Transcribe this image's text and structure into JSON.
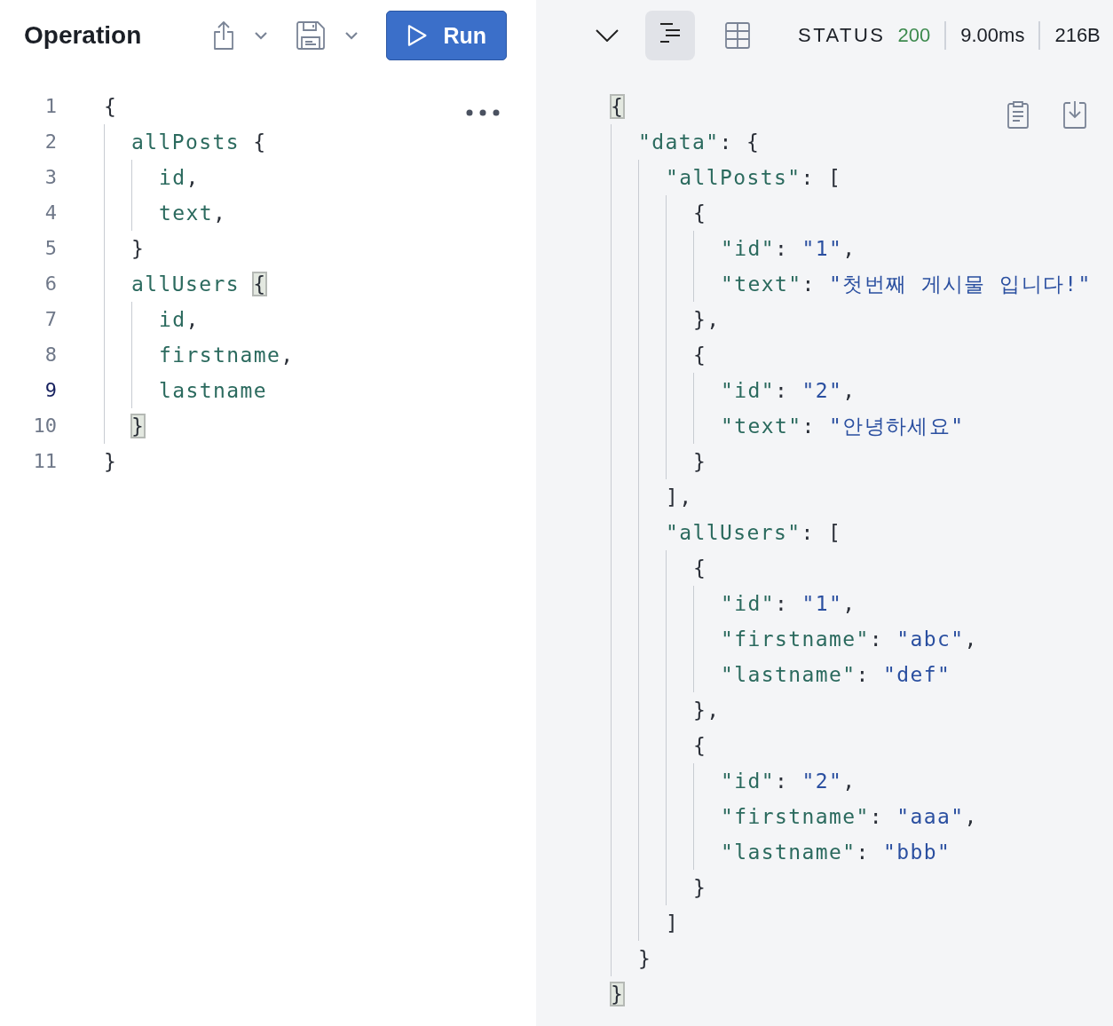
{
  "operation_panel": {
    "title": "Operation",
    "run_button": {
      "label": "Run"
    },
    "editor": {
      "lines": [
        {
          "num": "1",
          "current": false,
          "tokens": [
            {
              "text": "{",
              "kind": "punct"
            }
          ],
          "children": [
            {
              "num": "2",
              "current": false,
              "tokens": [
                {
                  "text": "allPosts",
                  "kind": "field"
                },
                {
                  "text": " {",
                  "kind": "punct"
                }
              ],
              "children": [
                {
                  "num": "3",
                  "current": false,
                  "tokens": [
                    {
                      "text": "id",
                      "kind": "field"
                    },
                    {
                      "text": ",",
                      "kind": "punct"
                    }
                  ]
                },
                {
                  "num": "4",
                  "current": false,
                  "tokens": [
                    {
                      "text": "text",
                      "kind": "field"
                    },
                    {
                      "text": ",",
                      "kind": "punct"
                    }
                  ]
                }
              ]
            },
            {
              "num": "5",
              "current": false,
              "tokens": [
                {
                  "text": "}",
                  "kind": "punct"
                }
              ]
            },
            {
              "num": "6",
              "current": false,
              "tokens": [
                {
                  "text": "allUsers",
                  "kind": "field"
                },
                {
                  "text": " {",
                  "kind": "match"
                }
              ],
              "children": [
                {
                  "num": "7",
                  "current": false,
                  "tokens": [
                    {
                      "text": "id",
                      "kind": "field"
                    },
                    {
                      "text": ",",
                      "kind": "punct"
                    }
                  ]
                },
                {
                  "num": "8",
                  "current": false,
                  "tokens": [
                    {
                      "text": "firstname",
                      "kind": "field"
                    },
                    {
                      "text": ",",
                      "kind": "punct"
                    }
                  ]
                },
                {
                  "num": "9",
                  "current": true,
                  "tokens": [
                    {
                      "text": "lastname",
                      "kind": "field"
                    }
                  ]
                }
              ]
            },
            {
              "num": "10",
              "current": false,
              "tokens": [
                {
                  "text": "}",
                  "kind": "match"
                }
              ]
            }
          ]
        },
        {
          "num": "11",
          "current": false,
          "tokens": [
            {
              "text": "}",
              "kind": "punct"
            }
          ]
        }
      ]
    }
  },
  "response_panel": {
    "view_toggles": [
      {
        "kind": "tree",
        "selected": true
      },
      {
        "kind": "table",
        "selected": false
      }
    ],
    "status": {
      "label": "STATUS",
      "code": "200",
      "time": "9.00ms",
      "size": "216B"
    },
    "result": {
      "lines": [
        {
          "tokens": [
            {
              "text": "{",
              "kind": "match"
            }
          ],
          "children": [
            {
              "tokens": [
                {
                  "text": "\"data\"",
                  "kind": "key"
                },
                {
                  "text": ": {",
                  "kind": "punct"
                }
              ],
              "children": [
                {
                  "tokens": [
                    {
                      "text": "\"allPosts\"",
                      "kind": "key"
                    },
                    {
                      "text": ": [",
                      "kind": "punct"
                    }
                  ],
                  "children": [
                    {
                      "tokens": [
                        {
                          "text": "{",
                          "kind": "punct"
                        }
                      ],
                      "children": [
                        {
                          "tokens": [
                            {
                              "text": "\"id\"",
                              "kind": "key"
                            },
                            {
                              "text": ": ",
                              "kind": "punct"
                            },
                            {
                              "text": "\"1\"",
                              "kind": "string"
                            },
                            {
                              "text": ",",
                              "kind": "punct"
                            }
                          ]
                        },
                        {
                          "tokens": [
                            {
                              "text": "\"text\"",
                              "kind": "key"
                            },
                            {
                              "text": ": ",
                              "kind": "punct"
                            },
                            {
                              "text": "\"첫번째 게시물 입니다!\"",
                              "kind": "string"
                            }
                          ]
                        }
                      ]
                    },
                    {
                      "tokens": [
                        {
                          "text": "},",
                          "kind": "punct"
                        }
                      ]
                    },
                    {
                      "tokens": [
                        {
                          "text": "{",
                          "kind": "punct"
                        }
                      ],
                      "children": [
                        {
                          "tokens": [
                            {
                              "text": "\"id\"",
                              "kind": "key"
                            },
                            {
                              "text": ": ",
                              "kind": "punct"
                            },
                            {
                              "text": "\"2\"",
                              "kind": "string"
                            },
                            {
                              "text": ",",
                              "kind": "punct"
                            }
                          ]
                        },
                        {
                          "tokens": [
                            {
                              "text": "\"text\"",
                              "kind": "key"
                            },
                            {
                              "text": ": ",
                              "kind": "punct"
                            },
                            {
                              "text": "\"안녕하세요\"",
                              "kind": "string"
                            }
                          ]
                        }
                      ]
                    },
                    {
                      "tokens": [
                        {
                          "text": "}",
                          "kind": "punct"
                        }
                      ]
                    }
                  ]
                },
                {
                  "tokens": [
                    {
                      "text": "],",
                      "kind": "punct"
                    }
                  ]
                },
                {
                  "tokens": [
                    {
                      "text": "\"allUsers\"",
                      "kind": "key"
                    },
                    {
                      "text": ": [",
                      "kind": "punct"
                    }
                  ],
                  "children": [
                    {
                      "tokens": [
                        {
                          "text": "{",
                          "kind": "punct"
                        }
                      ],
                      "children": [
                        {
                          "tokens": [
                            {
                              "text": "\"id\"",
                              "kind": "key"
                            },
                            {
                              "text": ": ",
                              "kind": "punct"
                            },
                            {
                              "text": "\"1\"",
                              "kind": "string"
                            },
                            {
                              "text": ",",
                              "kind": "punct"
                            }
                          ]
                        },
                        {
                          "tokens": [
                            {
                              "text": "\"firstname\"",
                              "kind": "key"
                            },
                            {
                              "text": ": ",
                              "kind": "punct"
                            },
                            {
                              "text": "\"abc\"",
                              "kind": "string"
                            },
                            {
                              "text": ",",
                              "kind": "punct"
                            }
                          ]
                        },
                        {
                          "tokens": [
                            {
                              "text": "\"lastname\"",
                              "kind": "key"
                            },
                            {
                              "text": ": ",
                              "kind": "punct"
                            },
                            {
                              "text": "\"def\"",
                              "kind": "string"
                            }
                          ]
                        }
                      ]
                    },
                    {
                      "tokens": [
                        {
                          "text": "},",
                          "kind": "punct"
                        }
                      ]
                    },
                    {
                      "tokens": [
                        {
                          "text": "{",
                          "kind": "punct"
                        }
                      ],
                      "children": [
                        {
                          "tokens": [
                            {
                              "text": "\"id\"",
                              "kind": "key"
                            },
                            {
                              "text": ": ",
                              "kind": "punct"
                            },
                            {
                              "text": "\"2\"",
                              "kind": "string"
                            },
                            {
                              "text": ",",
                              "kind": "punct"
                            }
                          ]
                        },
                        {
                          "tokens": [
                            {
                              "text": "\"firstname\"",
                              "kind": "key"
                            },
                            {
                              "text": ": ",
                              "kind": "punct"
                            },
                            {
                              "text": "\"aaa\"",
                              "kind": "string"
                            },
                            {
                              "text": ",",
                              "kind": "punct"
                            }
                          ]
                        },
                        {
                          "tokens": [
                            {
                              "text": "\"lastname\"",
                              "kind": "key"
                            },
                            {
                              "text": ": ",
                              "kind": "punct"
                            },
                            {
                              "text": "\"bbb\"",
                              "kind": "string"
                            }
                          ]
                        }
                      ]
                    },
                    {
                      "tokens": [
                        {
                          "text": "}",
                          "kind": "punct"
                        }
                      ]
                    }
                  ]
                },
                {
                  "tokens": [
                    {
                      "text": "]",
                      "kind": "punct"
                    }
                  ]
                }
              ]
            },
            {
              "tokens": [
                {
                  "text": "}",
                  "kind": "punct"
                }
              ]
            }
          ]
        },
        {
          "tokens": [
            {
              "text": "}",
              "kind": "match"
            }
          ]
        }
      ]
    }
  }
}
